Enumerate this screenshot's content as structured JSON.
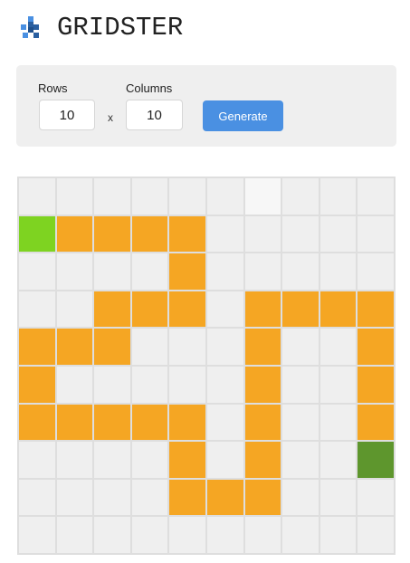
{
  "app": {
    "title": "GRIDSTER",
    "logo_icon": "grid-logo-icon"
  },
  "controls": {
    "rows_label": "Rows",
    "rows_value": "10",
    "times_symbol": "x",
    "columns_label": "Columns",
    "columns_value": "10",
    "generate_label": "Generate"
  },
  "colors": {
    "empty": "#efefef",
    "path": "#f5a623",
    "start": "#7ed321",
    "end": "#5e962d",
    "accent": "#4a90e2"
  },
  "grid": {
    "rows": 10,
    "columns": 10,
    "legend": {
      ".": "empty",
      "P": "path",
      "S": "start",
      "E": "end",
      "h": "hover"
    },
    "cells": [
      "......h...",
      "SPPPP.....",
      "....P.....",
      "..PPP.PPPP",
      "PPP...P..P",
      "P.....P..P",
      "PPPPP.P..P",
      "....P.P..E",
      "....PPP...",
      ".........."
    ]
  }
}
